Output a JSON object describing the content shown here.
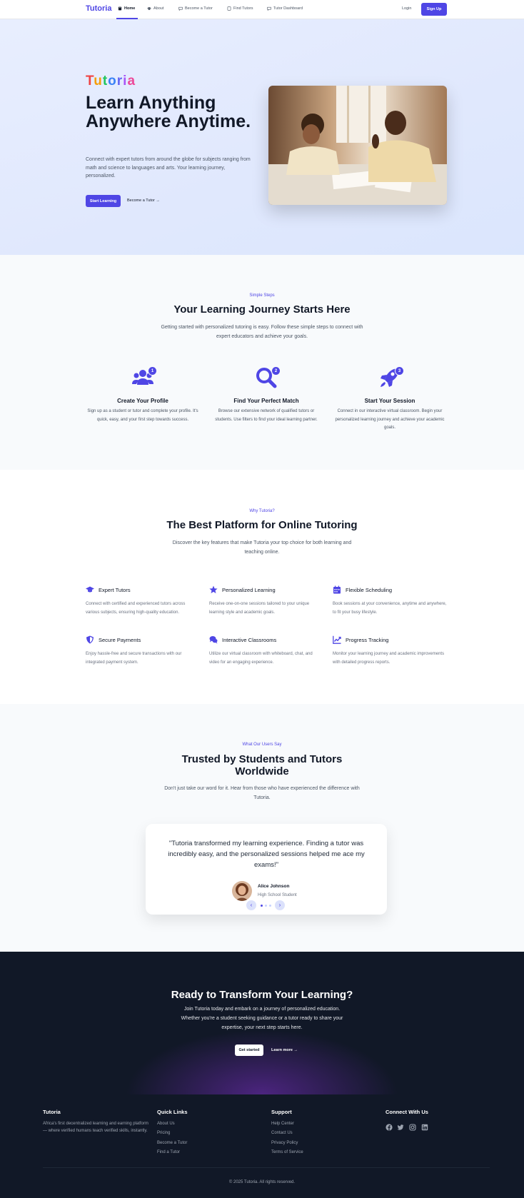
{
  "nav": {
    "brand": "Tutoria",
    "items": [
      {
        "label": "Home",
        "icon": "book-icon"
      },
      {
        "label": "About",
        "icon": "graduation-cap-icon"
      },
      {
        "label": "Become a Tutor",
        "icon": "chat-icon"
      },
      {
        "label": "Find Tutors",
        "icon": "book-icon"
      },
      {
        "label": "Tutor Dashboard",
        "icon": "chat-icon"
      }
    ],
    "login": "Login",
    "signup": "Sign Up"
  },
  "hero": {
    "logo": "Tutoria",
    "title": "Learn Anything Anywhere Anytime.",
    "subtitle": "Connect with expert tutors from around the globe for subjects ranging from math and science to languages and arts. Your learning journey, personalized.",
    "cta": "Start Learning",
    "link": "Become a Tutor →"
  },
  "steps": {
    "eyebrow": "Simple Steps",
    "title": "Your Learning Journey Starts Here",
    "subtitle": "Getting started with personalized tutoring is easy. Follow these simple steps to connect with expert educators and achieve your goals.",
    "items": [
      {
        "badge": "1",
        "icon": "users-icon",
        "title": "Create Your Profile",
        "desc": "Sign up as a student or tutor and complete your profile. It's quick, easy, and your first step towards success."
      },
      {
        "badge": "2",
        "icon": "search-icon",
        "title": "Find Your Perfect Match",
        "desc": "Browse our extensive network of qualified tutors or students. Use filters to find your ideal learning partner."
      },
      {
        "badge": "3",
        "icon": "rocket-icon",
        "title": "Start Your Session",
        "desc": "Connect in our interactive virtual classroom. Begin your personalized learning journey and achieve your academic goals."
      }
    ]
  },
  "features": {
    "eyebrow": "Why Tutoria?",
    "title": "The Best Platform for Online Tutoring",
    "subtitle": "Discover the key features that make Tutoria your top choice for both learning and teaching online.",
    "items": [
      {
        "icon": "graduation-cap-icon",
        "title": "Expert Tutors",
        "desc": "Connect with certified and experienced tutors across various subjects, ensuring high-quality education."
      },
      {
        "icon": "star-icon",
        "title": "Personalized Learning",
        "desc": "Receive one-on-one sessions tailored to your unique learning style and academic goals."
      },
      {
        "icon": "calendar-icon",
        "title": "Flexible Scheduling",
        "desc": "Book sessions at your convenience, anytime and anywhere, to fit your busy lifestyle."
      },
      {
        "icon": "shield-icon",
        "title": "Secure Payments",
        "desc": "Enjoy hassle-free and secure transactions with our integrated payment system."
      },
      {
        "icon": "chat-bubbles-icon",
        "title": "Interactive Classrooms",
        "desc": "Utilize our virtual classroom with whiteboard, chat, and video for an engaging experience."
      },
      {
        "icon": "chart-line-icon",
        "title": "Progress Tracking",
        "desc": "Monitor your learning journey and academic improvements with detailed progress reports."
      }
    ]
  },
  "testimonials": {
    "eyebrow": "What Our Users Say",
    "title_line1": "Trusted by Students and Tutors",
    "title_line2": "Worldwide",
    "subtitle": "Don't just take our word for it. Hear from those who have experienced the difference with Tutoria.",
    "quote": "\"Tutoria transformed my learning experience. Finding a tutor was incredibly easy, and the personalized sessions helped me ace my exams!\"",
    "author": "Alice Johnson",
    "role": "High School Student",
    "prev": "‹",
    "next": "›"
  },
  "cta": {
    "title": "Ready to Transform Your Learning?",
    "subtitle": "Join Tutoria today and embark on a journey of personalized education. Whether you're a student seeking guidance or a tutor ready to share your expertise, your next step starts here.",
    "button": "Get started",
    "link": "Learn more →"
  },
  "footer": {
    "brand": "Tutoria",
    "description": "Africa's first decentralized learning and earning platform — where verified humans teach verified skills, instantly.",
    "quick_links_title": "Quick Links",
    "quick_links": [
      "About Us",
      "Pricing",
      "Become a Tutor",
      "Find a Tutor"
    ],
    "support_title": "Support",
    "support_links": [
      "Help Center",
      "Contact Us",
      "Privacy Policy",
      "Terms of Service"
    ],
    "connect_title": "Connect With Us",
    "socials": [
      "facebook-icon",
      "twitter-icon",
      "instagram-icon",
      "linkedin-icon"
    ],
    "copyright": "© 2025 Tutoria. All rights reserved."
  },
  "colors": {
    "accent": "#4f46e5",
    "dark": "#111827"
  }
}
